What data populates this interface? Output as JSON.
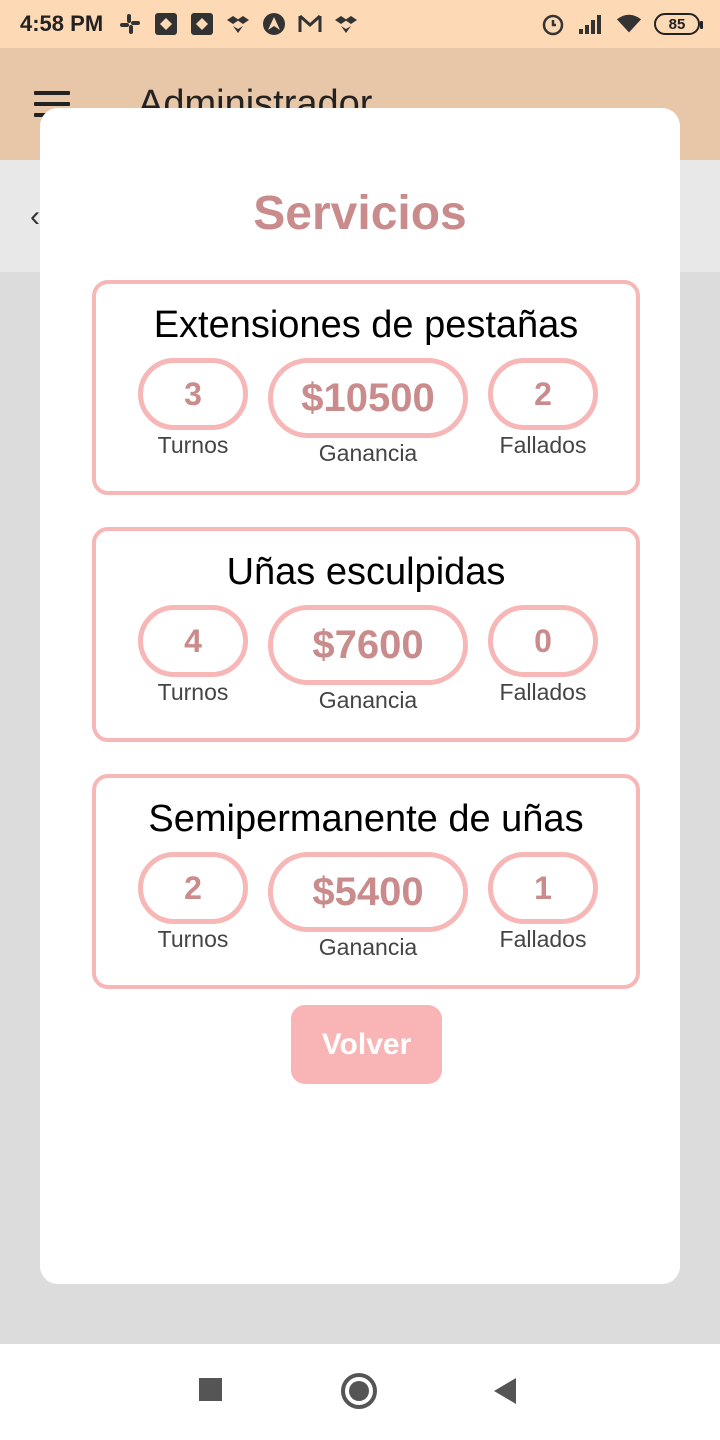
{
  "status_bar": {
    "time": "4:58 PM",
    "battery": "85",
    "left_icons": [
      "slack-icon",
      "app-icon",
      "app-icon",
      "dropbox-icon",
      "arch-icon",
      "gmail-icon",
      "dropbox-icon"
    ],
    "right_icons": [
      "alarm-icon",
      "signal-icon",
      "wifi-icon",
      "battery-icon"
    ]
  },
  "app_bar": {
    "title": "Administrador",
    "menu_icon": "hamburger-menu-icon"
  },
  "dialog": {
    "title": "Servicios",
    "services": [
      {
        "name": "Extensiones de pestañas",
        "turnos": "3",
        "ganancia": "$10500",
        "fallados": "2"
      },
      {
        "name": "Uñas esculpidas",
        "turnos": "4",
        "ganancia": "$7600",
        "fallados": "0"
      },
      {
        "name": "Semipermanente de uñas",
        "turnos": "2",
        "ganancia": "$5400",
        "fallados": "1"
      }
    ],
    "labels": {
      "turnos": "Turnos",
      "ganancia": "Ganancia",
      "fallados": "Fallados"
    },
    "back_button": "Volver"
  },
  "colors": {
    "status_bar_bg": "#fdd9b5",
    "app_bar_bg": "#e8c7a8",
    "accent_text": "#c98b8b",
    "pill_border": "#f7b7b7",
    "button_bg": "#f9b5b5"
  }
}
